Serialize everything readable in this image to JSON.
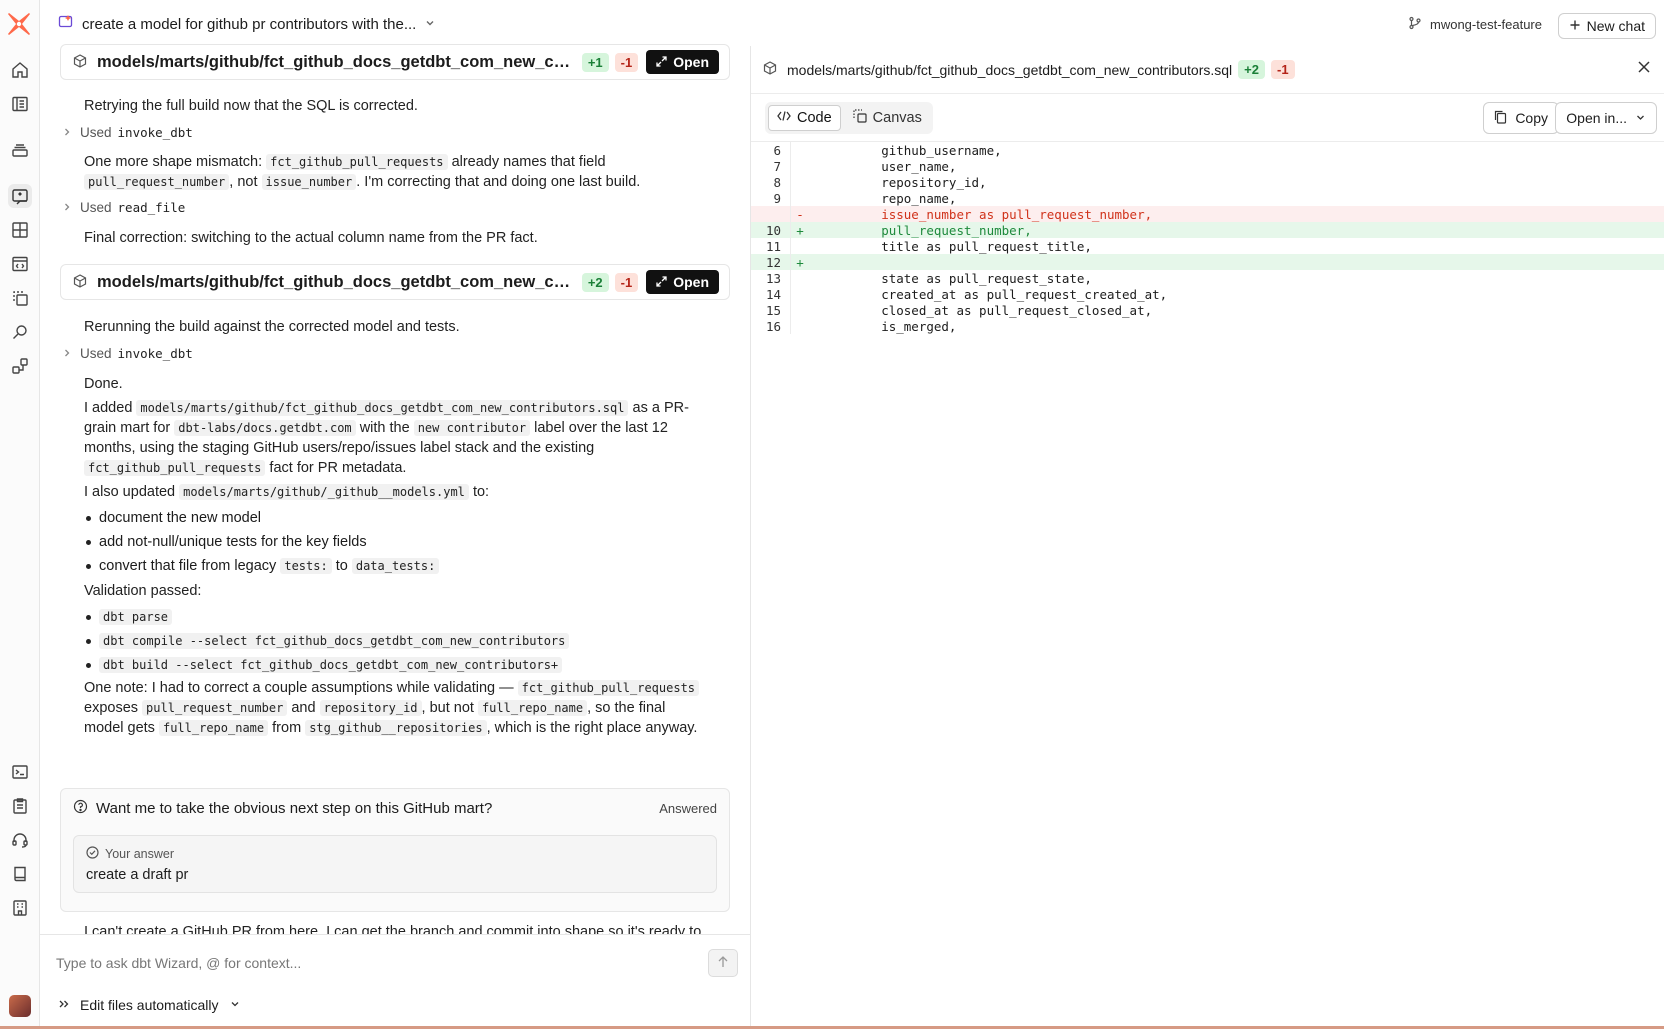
{
  "header": {
    "chat_title": "create a model for github pr contributors with the...",
    "branch": "mwong-test-feature",
    "new_chat_label": "New chat"
  },
  "chat": {
    "file_card_1": {
      "path": "models/marts/github/fct_github_docs_getdbt_com_new_contributors.sql",
      "additions": "+1",
      "deletions": "-1",
      "open_label": "Open"
    },
    "msg_1": "Retrying the full build now that the SQL is corrected.",
    "used_1": {
      "label": "Used",
      "tool": "invoke_dbt"
    },
    "msg_2": {
      "t1": "One more shape mismatch:",
      "c1": "fct_github_pull_requests",
      "t2": "already names that field",
      "c2": "pull_request_number",
      "t3": ", not",
      "c3": "issue_number",
      "t4": ". I'm correcting that and doing one last build."
    },
    "used_2": {
      "label": "Used",
      "tool": "read_file"
    },
    "msg_3": "Final correction: switching to the actual column name from the PR fact.",
    "file_card_2": {
      "path": "models/marts/github/fct_github_docs_getdbt_com_new_contributors.sql",
      "additions": "+2",
      "deletions": "-1",
      "open_label": "Open"
    },
    "msg_4": "Rerunning the build against the corrected model and tests.",
    "used_3": {
      "label": "Used",
      "tool": "invoke_dbt"
    },
    "done": "Done.",
    "summary": {
      "t1": "I added",
      "c1": "models/marts/github/fct_github_docs_getdbt_com_new_contributors.sql",
      "t2": "as a PR-",
      "t3": "grain mart for",
      "c2": "dbt-labs/docs.getdbt.com",
      "t4": "with the",
      "c3": "new contributor",
      "t5": "label over the last 12",
      "t6": "months, using the staging GitHub users/repo/issues label stack and the existing",
      "c4": "fct_github_pull_requests",
      "t7": "fact for PR metadata."
    },
    "updated": {
      "t1": "I also updated",
      "c1": "models/marts/github/_github__models.yml",
      "t2": "to:"
    },
    "bullets": {
      "b1": "document the new model",
      "b2": "add not-null/unique tests for the key fields",
      "b3_t1": "convert that file from legacy",
      "b3_c1": "tests:",
      "b3_t2": "to",
      "b3_c2": "data_tests:"
    },
    "validation_label": "Validation passed:",
    "validation": [
      "dbt parse",
      "dbt compile --select fct_github_docs_getdbt_com_new_contributors",
      "dbt build --select fct_github_docs_getdbt_com_new_contributors+"
    ],
    "note": {
      "t1": "One note: I had to correct a couple assumptions while validating —",
      "c1": "fct_github_pull_requests",
      "t2": "exposes",
      "c2": "pull_request_number",
      "t3": "and",
      "c3": "repository_id",
      "t4": ", but not",
      "c4": "full_repo_name",
      "t5": ", so the final",
      "t6": "model gets",
      "c5": "full_repo_name",
      "t7": "from",
      "c6": "stg_github__repositories",
      "t8": ", which is the right place anyway."
    },
    "question": {
      "title": "Want me to take the obvious next step on this GitHub mart?",
      "status": "Answered",
      "answer_label": "Your answer",
      "answer": "create a draft pr"
    },
    "trailing": "I can't create a GitHub PR from here. I can get the branch and commit into shape so it's ready to"
  },
  "input": {
    "placeholder": "Type to ask dbt Wizard, @ for context...",
    "mode_label": "Edit files automatically"
  },
  "panel": {
    "file_path": "models/marts/github/fct_github_docs_getdbt_com_new_contributors.sql",
    "additions": "+2",
    "deletions": "-1",
    "tabs": {
      "code": "Code",
      "canvas": "Canvas"
    },
    "copy_label": "Copy",
    "open_in_label": "Open in...",
    "lines": [
      {
        "n": "6",
        "mark": "",
        "type": "ctx",
        "text": "github_username,"
      },
      {
        "n": "7",
        "mark": "",
        "type": "ctx",
        "text": "user_name,"
      },
      {
        "n": "8",
        "mark": "",
        "type": "ctx",
        "text": "repository_id,"
      },
      {
        "n": "9",
        "mark": "",
        "type": "ctx",
        "text": "repo_name,"
      },
      {
        "n": "",
        "mark": "-",
        "type": "del",
        "text": "issue_number as pull_request_number,"
      },
      {
        "n": "10",
        "mark": "+",
        "type": "add",
        "text": "pull_request_number,"
      },
      {
        "n": "11",
        "mark": "",
        "type": "ctx",
        "text": "title as pull_request_title,"
      },
      {
        "n": "12",
        "mark": "+",
        "type": "add",
        "text": ""
      },
      {
        "n": "13",
        "mark": "",
        "type": "ctx",
        "text": "state as pull_request_state,"
      },
      {
        "n": "14",
        "mark": "",
        "type": "ctx",
        "text": "created_at as pull_request_created_at,"
      },
      {
        "n": "15",
        "mark": "",
        "type": "ctx",
        "text": "closed_at as pull_request_closed_at,"
      },
      {
        "n": "16",
        "mark": "",
        "type": "ctx",
        "text": "is_merged,"
      }
    ]
  },
  "colors": {
    "brand": "#ff694a",
    "add": "#1e8a3c",
    "del": "#d0321a"
  }
}
